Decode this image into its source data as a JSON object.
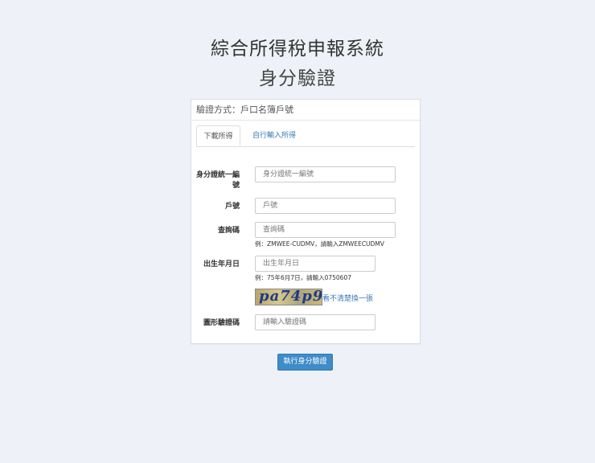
{
  "header": {
    "title": "綜合所得稅申報系統",
    "subtitle": "身分驗證"
  },
  "panel": {
    "heading": "驗證方式：戶口名簿戶號",
    "tabs": [
      {
        "label": "下載所得",
        "active": true
      },
      {
        "label": "自行輸入所得",
        "active": false
      }
    ]
  },
  "form": {
    "id_label": "身分證統一編號",
    "id_placeholder": "身分證統一編號",
    "household_label": "戶號",
    "household_placeholder": "戶號",
    "query_label": "查詢碼",
    "query_placeholder": "查詢碼",
    "query_hint": "例：ZMWEE-CUDMV，請輸入ZMWEECUDMV",
    "birth_label": "出生年月日",
    "birth_placeholder": "出生年月日",
    "birth_hint": "例：75年6月7日，請輸入0750607",
    "captcha_text": "pa74p9",
    "captcha_refresh": "看不清楚換一張",
    "captcha_label": "圖形驗證碼",
    "captcha_placeholder": "請輸入驗證碼"
  },
  "actions": {
    "submit_label": "執行身分驗證"
  },
  "colors": {
    "background": "#eef1f7",
    "primary": "#3e8cc8",
    "link": "#3a79b5"
  }
}
